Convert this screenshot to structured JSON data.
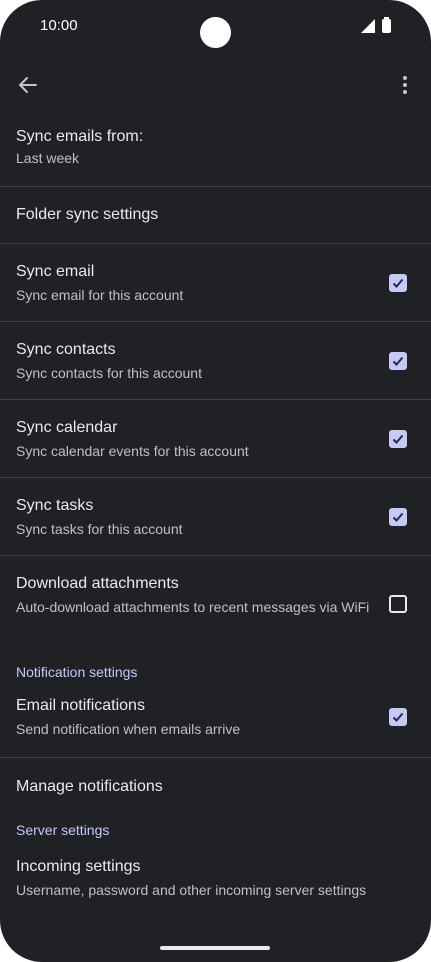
{
  "status": {
    "time": "10:00"
  },
  "sync_from": {
    "title": "Sync emails from:",
    "value": "Last week"
  },
  "folder_sync": {
    "title": "Folder sync settings"
  },
  "sync_email": {
    "title": "Sync email",
    "subtitle": "Sync email for this account",
    "checked": true
  },
  "sync_contacts": {
    "title": "Sync contacts",
    "subtitle": "Sync contacts for this account",
    "checked": true
  },
  "sync_calendar": {
    "title": "Sync calendar",
    "subtitle": "Sync calendar events for this account",
    "checked": true
  },
  "sync_tasks": {
    "title": "Sync tasks",
    "subtitle": "Sync tasks for this account",
    "checked": true
  },
  "download_attachments": {
    "title": "Download attachments",
    "subtitle": "Auto-download attachments to recent messages via WiFi",
    "checked": false
  },
  "notification_header": "Notification settings",
  "email_notifications": {
    "title": "Email notifications",
    "subtitle": "Send notification when emails arrive",
    "checked": true
  },
  "manage_notifications": {
    "title": "Manage notifications"
  },
  "server_header": "Server settings",
  "incoming_settings": {
    "title": "Incoming settings",
    "subtitle": "Username, password and other incoming server settings"
  },
  "colors": {
    "background": "#202124",
    "accent": "#c3c8ff",
    "checkbox": "#c6c9f4"
  }
}
